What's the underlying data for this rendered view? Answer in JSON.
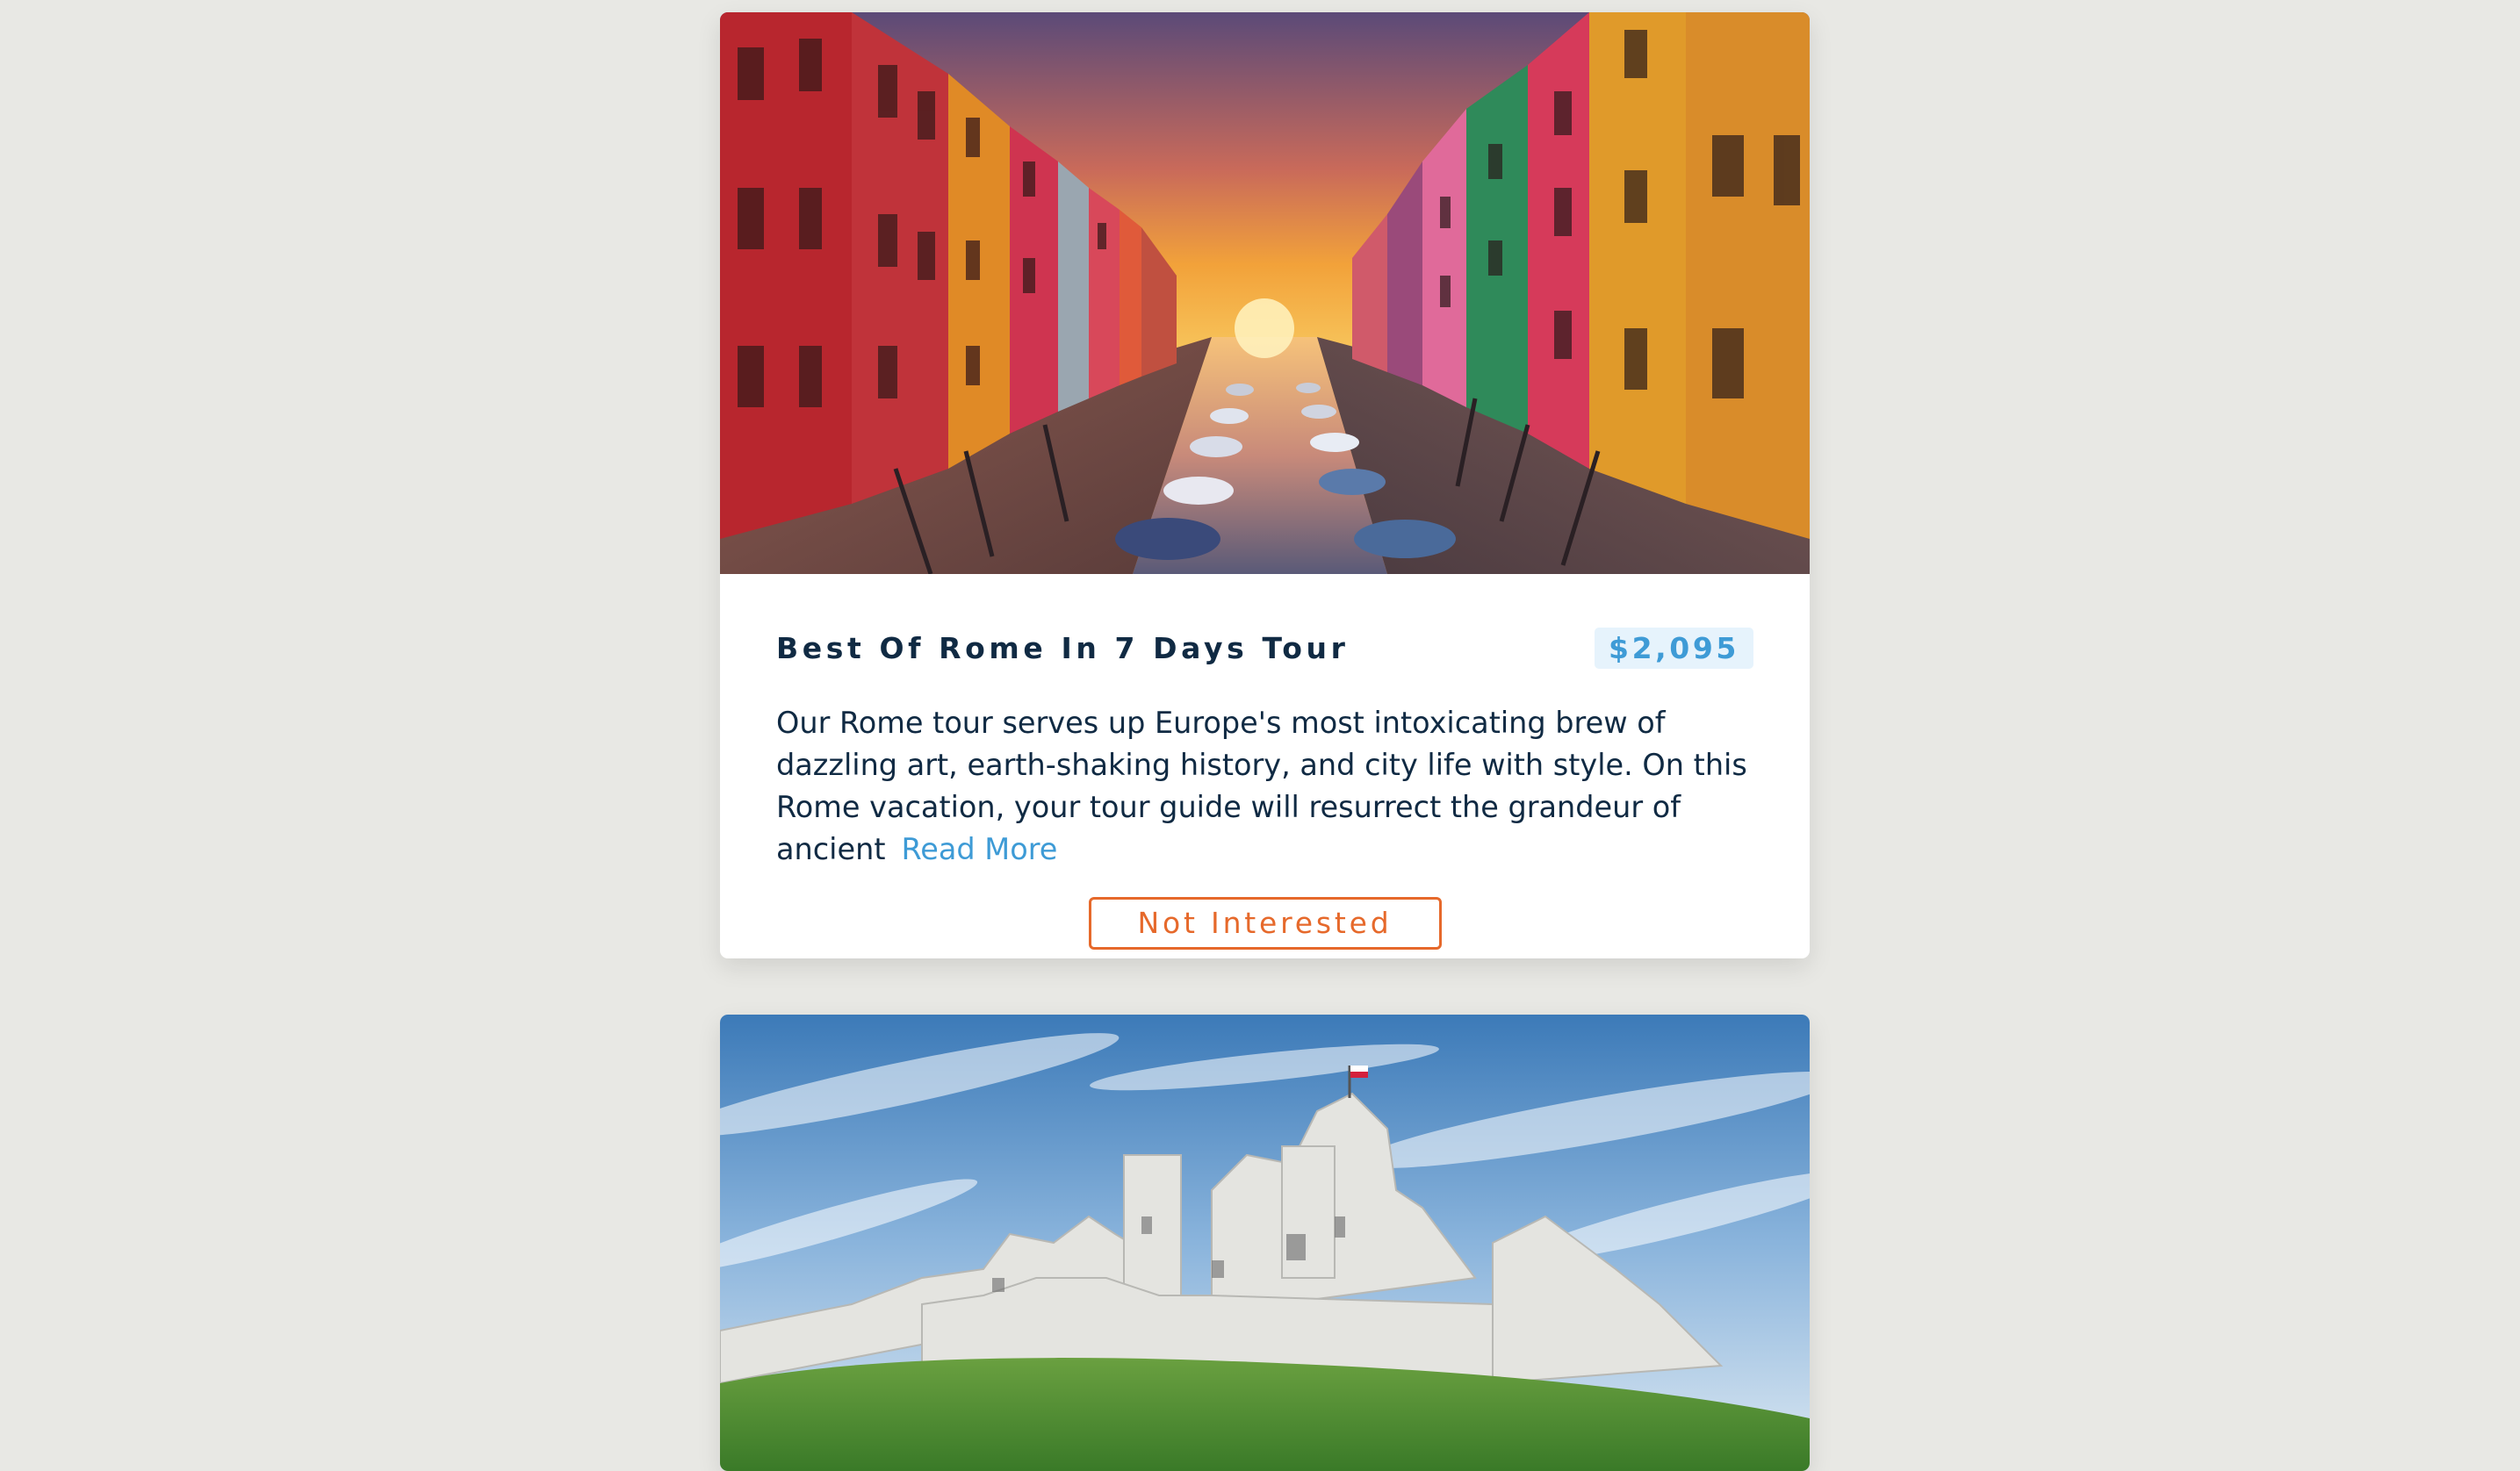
{
  "tours": [
    {
      "image_alt": "burano canal at sunset",
      "title": "Best Of Rome In 7 Days Tour",
      "price": "$2,095",
      "info": "Our Rome tour serves up Europe's most intoxicating brew of dazzling art, earth-shaking history, and city life with style. On this Rome vacation, your tour guide will resurrect the grandeur of ancient",
      "read_more_label": "Read More",
      "not_interested_label": "Not Interested"
    },
    {
      "image_alt": "castle ruins on a hill"
    }
  ],
  "colors": {
    "background": "#e8e8e4",
    "card": "#ffffff",
    "title": "#102a43",
    "accent_blue": "#3e9bd6",
    "price_bg": "#e6f3fc",
    "accent_orange": "#e6692b"
  }
}
